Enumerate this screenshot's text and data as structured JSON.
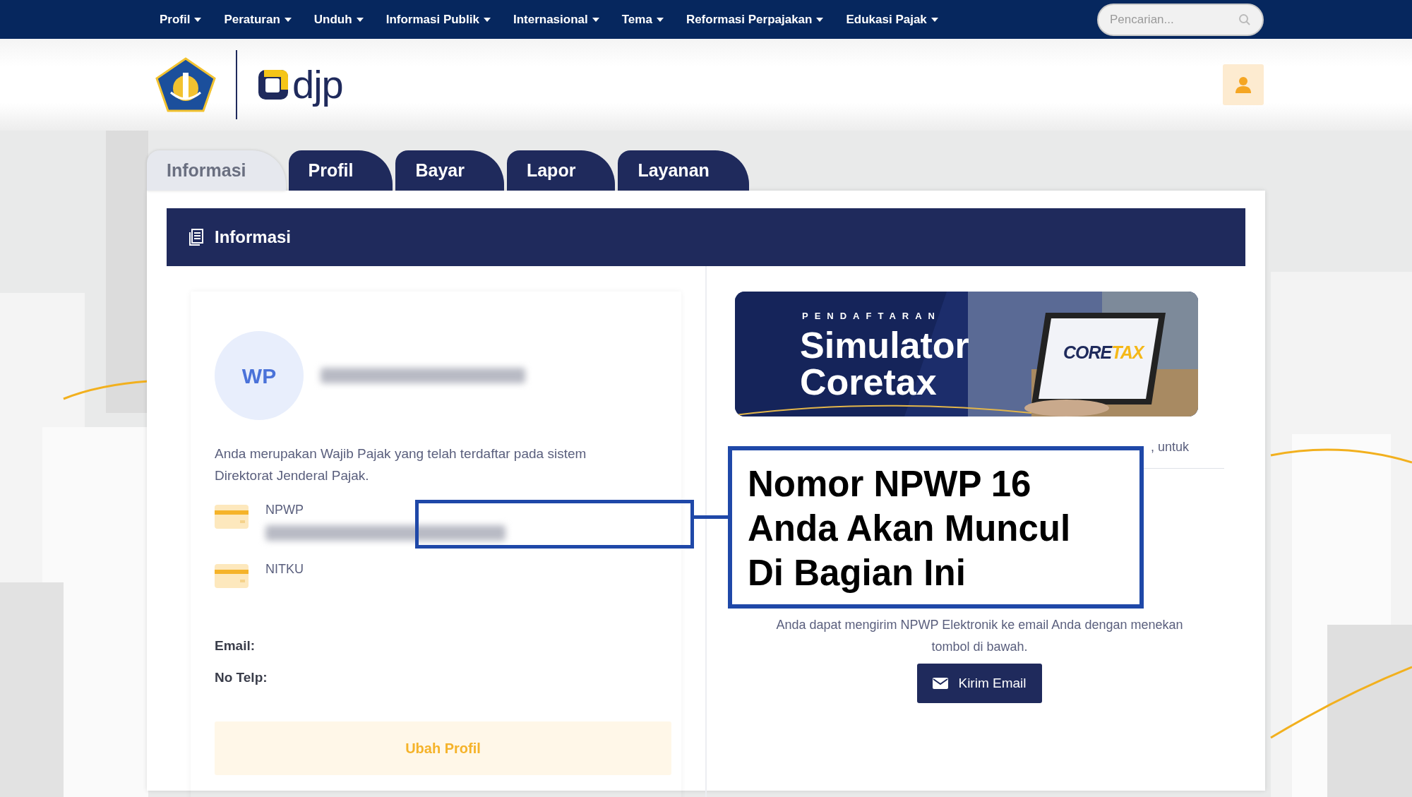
{
  "topnav": {
    "items": [
      {
        "label": "Profil",
        "dropdown": true
      },
      {
        "label": "Peraturan",
        "dropdown": true
      },
      {
        "label": "Unduh",
        "dropdown": true
      },
      {
        "label": "Informasi Publik",
        "dropdown": true
      },
      {
        "label": "Internasional",
        "dropdown": true
      },
      {
        "label": "Tema",
        "dropdown": true
      },
      {
        "label": "Reformasi Perpajakan",
        "dropdown": true
      },
      {
        "label": "Edukasi Pajak",
        "dropdown": true
      }
    ],
    "search": {
      "placeholder": "Pencarian..."
    }
  },
  "header": {
    "logo_text": "djp"
  },
  "tabs": [
    {
      "label": "Informasi",
      "selected": true
    },
    {
      "label": "Profil",
      "selected": false
    },
    {
      "label": "Bayar",
      "selected": false
    },
    {
      "label": "Lapor",
      "selected": false
    },
    {
      "label": "Layanan",
      "selected": false
    }
  ],
  "panel": {
    "title": "Informasi"
  },
  "profile": {
    "avatar": "WP",
    "description": "Anda merupakan Wajib Pajak yang telah terdaftar pada sistem Direktorat Jenderal Pajak.",
    "ids": [
      {
        "label": "NPWP",
        "redacted": true
      },
      {
        "label": "NITKU",
        "redacted": false
      }
    ],
    "contacts": [
      "Email:",
      "No Telp:"
    ],
    "button": "Ubah Profil"
  },
  "banner": {
    "kicker": "PENDAFTARAN",
    "title_lines": [
      "Simulator",
      "Coretax"
    ],
    "logo": [
      "CORE",
      "TAX"
    ]
  },
  "info": {
    "note": ", untuk",
    "email_note": "Anda dapat mengirim NPWP Elektronik ke email Anda dengan menekan tombol di bawah.",
    "button": "Kirim Email"
  },
  "annotation": {
    "text": "Nomor NPWP 16 Anda Akan Muncul Di Bagian Ini"
  }
}
